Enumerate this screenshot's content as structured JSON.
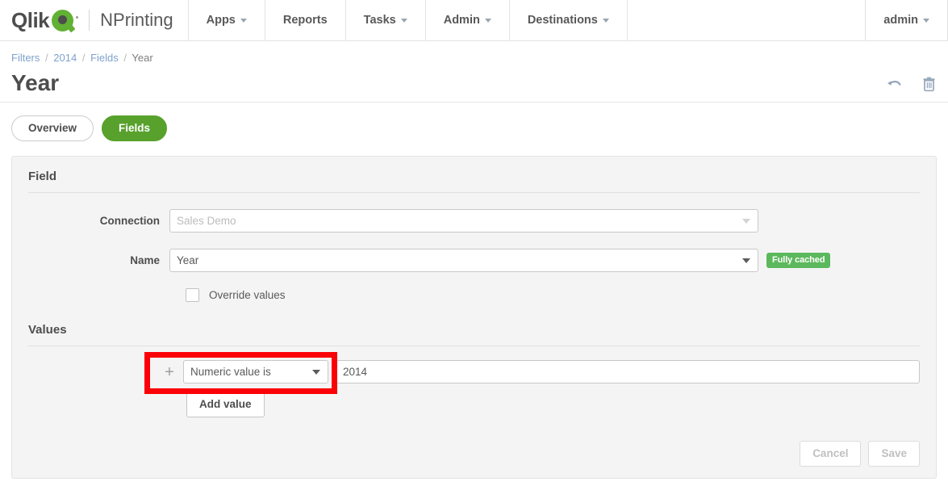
{
  "topnav": {
    "logo_word": "Qlik",
    "product": "NPrinting",
    "items": [
      {
        "label": "Apps",
        "has_caret": true
      },
      {
        "label": "Reports",
        "has_caret": false
      },
      {
        "label": "Tasks",
        "has_caret": true
      },
      {
        "label": "Admin",
        "has_caret": true
      },
      {
        "label": "Destinations",
        "has_caret": true
      }
    ],
    "user": {
      "label": "admin",
      "has_caret": true
    }
  },
  "breadcrumb": {
    "items": [
      "Filters",
      "2014",
      "Fields"
    ],
    "current": "Year",
    "separator": "/"
  },
  "page": {
    "title": "Year",
    "actions": [
      {
        "name": "undo-icon",
        "title": "Undo"
      },
      {
        "name": "trash-icon",
        "title": "Delete"
      }
    ]
  },
  "tabs": [
    {
      "label": "Overview",
      "active": false
    },
    {
      "label": "Fields",
      "active": true
    }
  ],
  "field_section": {
    "title": "Field",
    "connection": {
      "label": "Connection",
      "value": "Sales Demo",
      "disabled": true
    },
    "name": {
      "label": "Name",
      "value": "Year",
      "badge": "Fully cached"
    },
    "override": {
      "label": "Override values",
      "checked": false
    }
  },
  "values_section": {
    "title": "Values",
    "rows": [
      {
        "add_icon": "+",
        "operator": "Numeric value is",
        "value": "2014"
      }
    ],
    "add_value_label": "Add value"
  },
  "footer": {
    "cancel_label": "Cancel",
    "save_label": "Save",
    "cancel_disabled": true,
    "save_disabled": true
  },
  "colors": {
    "brand_green": "#61b133",
    "tab_active_green": "#58a12c",
    "badge_green": "#5cb85c",
    "annotation_red": "#fb0006",
    "panel_bg": "#f4f4f4",
    "text_dark": "#4d4d4d",
    "link_blue": "#7ea2cc"
  }
}
